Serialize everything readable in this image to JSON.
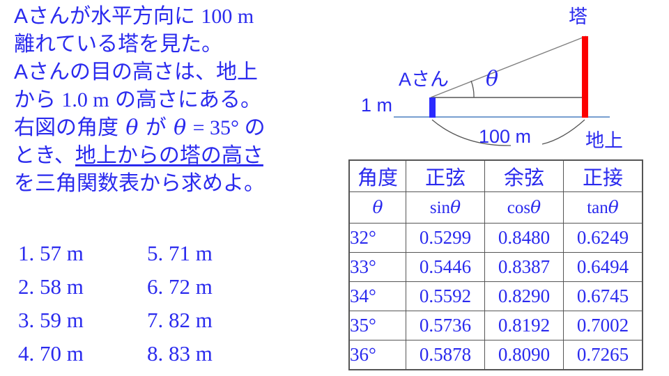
{
  "colors": {
    "text_blue": "#2a2aee",
    "bar_blue": "#2b2bff",
    "tower_red": "#fc0000",
    "line_gray": "#555555",
    "ground_blue": "#4a7fc1"
  },
  "problem": {
    "lines": [
      {
        "parts": [
          {
            "t": "Aさんが水平方向に ",
            "s": "jp"
          },
          {
            "t": "100 m",
            "s": "num"
          }
        ]
      },
      {
        "parts": [
          {
            "t": "離れている塔を見た。",
            "s": "jp"
          }
        ]
      },
      {
        "parts": [
          {
            "t": "Aさんの目の高さは、地上",
            "s": "jp"
          }
        ]
      },
      {
        "parts": [
          {
            "t": "から ",
            "s": "jp"
          },
          {
            "t": "1.0 m",
            "s": "num"
          },
          {
            "t": " の高さにある。",
            "s": "jp"
          }
        ]
      },
      {
        "parts": [
          {
            "t": "右図の角度 ",
            "s": "jp"
          },
          {
            "t": "θ",
            "s": "theta"
          },
          {
            "t": " が ",
            "s": "jp"
          },
          {
            "t": "θ",
            "s": "theta"
          },
          {
            "t": " = 35° ",
            "s": "num"
          },
          {
            "t": "の",
            "s": "jp"
          }
        ]
      },
      {
        "parts": [
          {
            "t": "とき、",
            "s": "jp"
          },
          {
            "t": "地上からの塔の高さ",
            "s": "ul"
          }
        ]
      },
      {
        "parts": [
          {
            "t": "を三角関数表から求めよ。",
            "s": "jp"
          }
        ]
      }
    ]
  },
  "answers": {
    "rows": [
      {
        "left": "1.  57 m",
        "right": "5.  71 m"
      },
      {
        "left": "2.  58 m",
        "right": "6.  72 m"
      },
      {
        "left": "3.  59 m",
        "right": "7.  82 m"
      },
      {
        "left": "4.  70 m",
        "right": "8.  83 m"
      }
    ]
  },
  "diagram": {
    "tower_label": "塔",
    "person_label": "Aさん",
    "eye_height_label": "1 m",
    "ground_label": "地上",
    "distance_label": "100 m",
    "angle_label": "θ"
  },
  "table": {
    "headers_jp": [
      "角度",
      "正弦",
      "余弦",
      "正接"
    ],
    "headers_sym": [
      "θ",
      "sinθ",
      "cosθ",
      "tanθ"
    ],
    "rows": [
      {
        "angle": "32°",
        "sin": "0.5299",
        "cos": "0.8480",
        "tan": "0.6249"
      },
      {
        "angle": "33°",
        "sin": "0.5446",
        "cos": "0.8387",
        "tan": "0.6494"
      },
      {
        "angle": "34°",
        "sin": "0.5592",
        "cos": "0.8290",
        "tan": "0.6745"
      },
      {
        "angle": "35°",
        "sin": "0.5736",
        "cos": "0.8192",
        "tan": "0.7002"
      },
      {
        "angle": "36°",
        "sin": "0.5878",
        "cos": "0.8090",
        "tan": "0.7265"
      }
    ]
  }
}
